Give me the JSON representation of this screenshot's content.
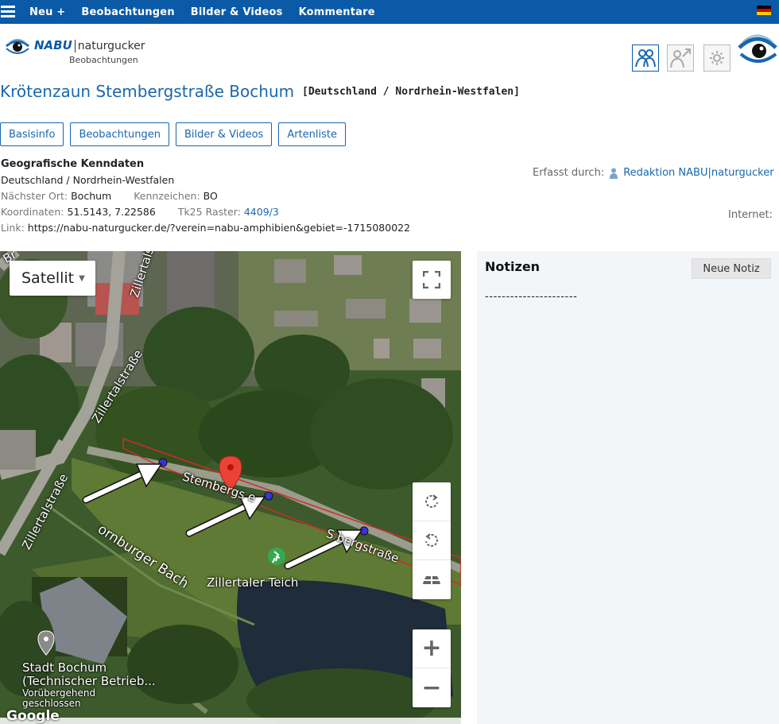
{
  "nav": {
    "menu_icon": "hamburger-icon",
    "items": [
      "Neu +",
      "Beobachtungen",
      "Bilder & Videos",
      "Kommentare"
    ],
    "flag": "german-flag-icon"
  },
  "logo": {
    "nabu": "NABU",
    "naturgucker": "naturgucker",
    "sub": "Beobachtungen"
  },
  "header": {
    "title": "Krötenzaun Stembergstraße Bochum",
    "region": "[Deutschland / Nordrhein-Westfalen]"
  },
  "tabs": [
    "Basisinfo",
    "Beobachtungen",
    "Bilder & Videos",
    "Artenliste"
  ],
  "geo": {
    "heading": "Geografische Kenndaten",
    "country_region": "Deutschland / Nordrhein-Westfalen",
    "nearest_label": "Nächster Ort:",
    "nearest_value": "Bochum",
    "plate_label": "Kennzeichen:",
    "plate_value": "BO",
    "coords_label": "Koordinaten:",
    "coords_value": "51.5143, 7.22586",
    "tk25_label": "Tk25 Raster:",
    "tk25_value": "4409/3",
    "link_label": "Link:",
    "link_value": "https://nabu-naturgucker.de/?verein=nabu-amphibien&gebiet=-1715080022"
  },
  "erfasst": {
    "label": "Erfasst durch:",
    "value": "Redaktion NABU|naturgucker"
  },
  "internet_label": "Internet:",
  "map": {
    "type_label": "Satellit",
    "labels": {
      "zillertal1": "Zillertalstraße",
      "zillertal2": "Zillertalstraße",
      "zillertal3": "Zillertalstraße",
      "stemberg1": "Stembergs",
      "stemberg1b": "e",
      "stemberg2": "S",
      "stemberg2b": "bergstraße",
      "bach": "Harpener-Hornburger Bach",
      "bach_visible": "ornburger Bach",
      "teich": "Zillertaler Teich",
      "stadt1": "Stadt Bochum",
      "stadt2": "(Technischer Betrieb...",
      "stadt3": "Vorübergehend",
      "stadt4": "geschlossen",
      "corner": "Br",
      "google": "Google"
    }
  },
  "notes": {
    "title": "Notizen",
    "button": "Neue Notiz",
    "separator": "----------------------"
  }
}
